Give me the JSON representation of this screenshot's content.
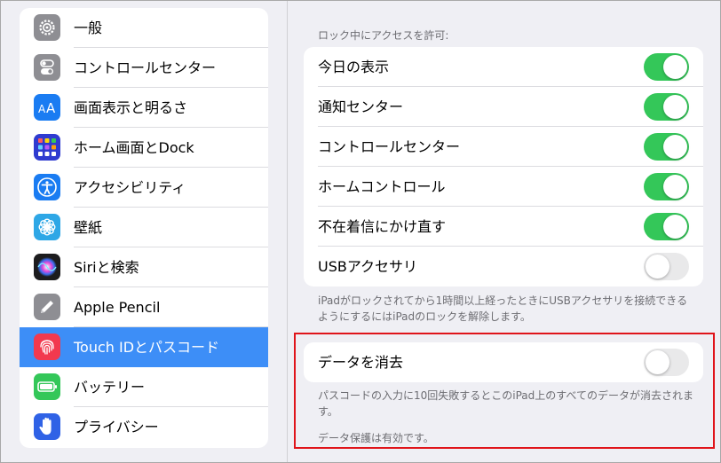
{
  "sidebar": {
    "items": [
      {
        "label": "一般",
        "icon": "gear-icon",
        "color": "#8e8e93",
        "selected": false
      },
      {
        "label": "コントロールセンター",
        "icon": "toggles-icon",
        "color": "#8e8e93",
        "selected": false
      },
      {
        "label": "画面表示と明るさ",
        "icon": "text-size-icon",
        "color": "#1a7cf2",
        "selected": false
      },
      {
        "label": "ホーム画面とDock",
        "icon": "app-grid-icon",
        "color": "#2f3bd0",
        "selected": false
      },
      {
        "label": "アクセシビリティ",
        "icon": "accessibility-icon",
        "color": "#1a7cf2",
        "selected": false
      },
      {
        "label": "壁紙",
        "icon": "flower-icon",
        "color": "#2ea7e6",
        "selected": false
      },
      {
        "label": "Siriと検索",
        "icon": "siri-icon",
        "color": "#1c1c1e",
        "selected": false
      },
      {
        "label": "Apple Pencil",
        "icon": "pencil-icon",
        "color": "#8e8e93",
        "selected": false
      },
      {
        "label": "Touch IDとパスコード",
        "icon": "fingerprint-icon",
        "color": "#f2394e",
        "selected": true
      },
      {
        "label": "バッテリー",
        "icon": "battery-icon",
        "color": "#34c759",
        "selected": false
      },
      {
        "label": "プライバシー",
        "icon": "hand-icon",
        "color": "#2f62e6",
        "selected": false
      }
    ]
  },
  "lock_access": {
    "header": "ロック中にアクセスを許可:",
    "rows": [
      {
        "label": "今日の表示",
        "on": true
      },
      {
        "label": "通知センター",
        "on": true
      },
      {
        "label": "コントロールセンター",
        "on": true
      },
      {
        "label": "ホームコントロール",
        "on": true
      },
      {
        "label": "不在着信にかけ直す",
        "on": true
      },
      {
        "label": "USBアクセサリ",
        "on": false
      }
    ],
    "footnote": "iPadがロックされてから1時間以上経ったときにUSBアクセサリを接続できるようにするにはiPadのロックを解除します。"
  },
  "erase_data": {
    "label": "データを消去",
    "on": false,
    "footnote1": "パスコードの入力に10回失敗するとこのiPad上のすべてのデータが消去されます。",
    "footnote2": "データ保護は有効です。"
  },
  "colors": {
    "toggle_on": "#34c759",
    "selection": "#3d8ef7",
    "highlight": "#e0141a"
  }
}
